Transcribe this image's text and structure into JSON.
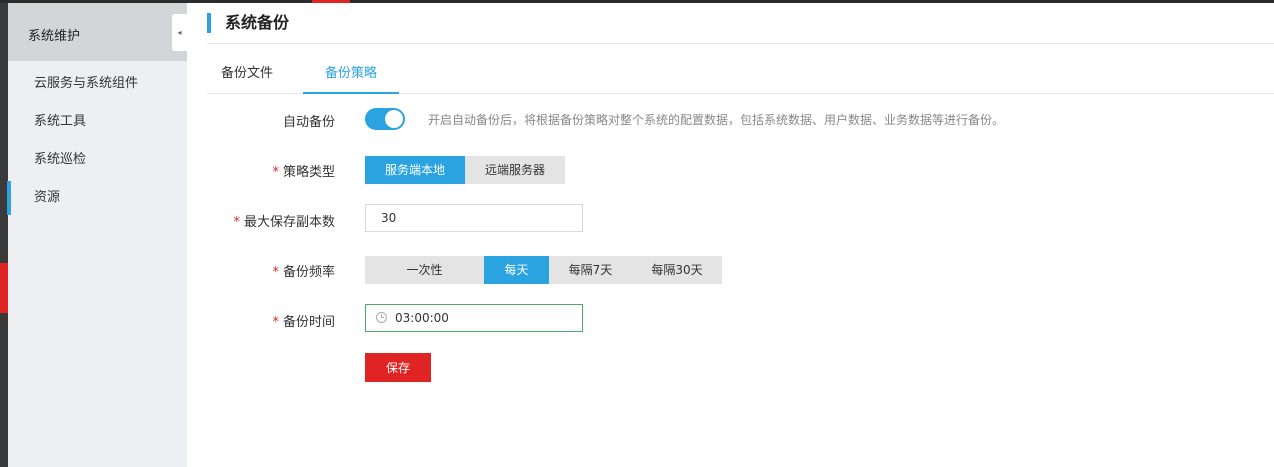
{
  "sidebar": {
    "title": "系统维护",
    "collapse_glyph": "◂",
    "items": [
      {
        "label": "云服务与系统组件"
      },
      {
        "label": "系统工具"
      },
      {
        "label": "系统巡检"
      },
      {
        "label": "资源"
      }
    ]
  },
  "page": {
    "title": "系统备份",
    "tabs": [
      {
        "label": "备份文件"
      },
      {
        "label": "备份策略"
      }
    ],
    "active_tab": "备份策略"
  },
  "form": {
    "auto_backup": {
      "label": "自动备份",
      "enabled": true,
      "hint": "开启自动备份后，将根据备份策略对整个系统的配置数据，包括系统数据、用户数据、业务数据等进行备份。"
    },
    "required_mark": "*",
    "strategy_type": {
      "label": "策略类型",
      "options": [
        "服务端本地",
        "远端服务器"
      ],
      "selected": "服务端本地"
    },
    "max_copies": {
      "label": "最大保存副本数",
      "value": "30"
    },
    "frequency": {
      "label": "备份频率",
      "options": [
        "一次性",
        "每天",
        "每隔7天",
        "每隔30天"
      ],
      "selected": "每天"
    },
    "backup_time": {
      "label": "备份时间",
      "value": "03:00:00"
    },
    "save_label": "保存"
  },
  "colors": {
    "accent": "#2aa3e0",
    "danger": "#e02424",
    "time_border": "#4ea96b"
  }
}
